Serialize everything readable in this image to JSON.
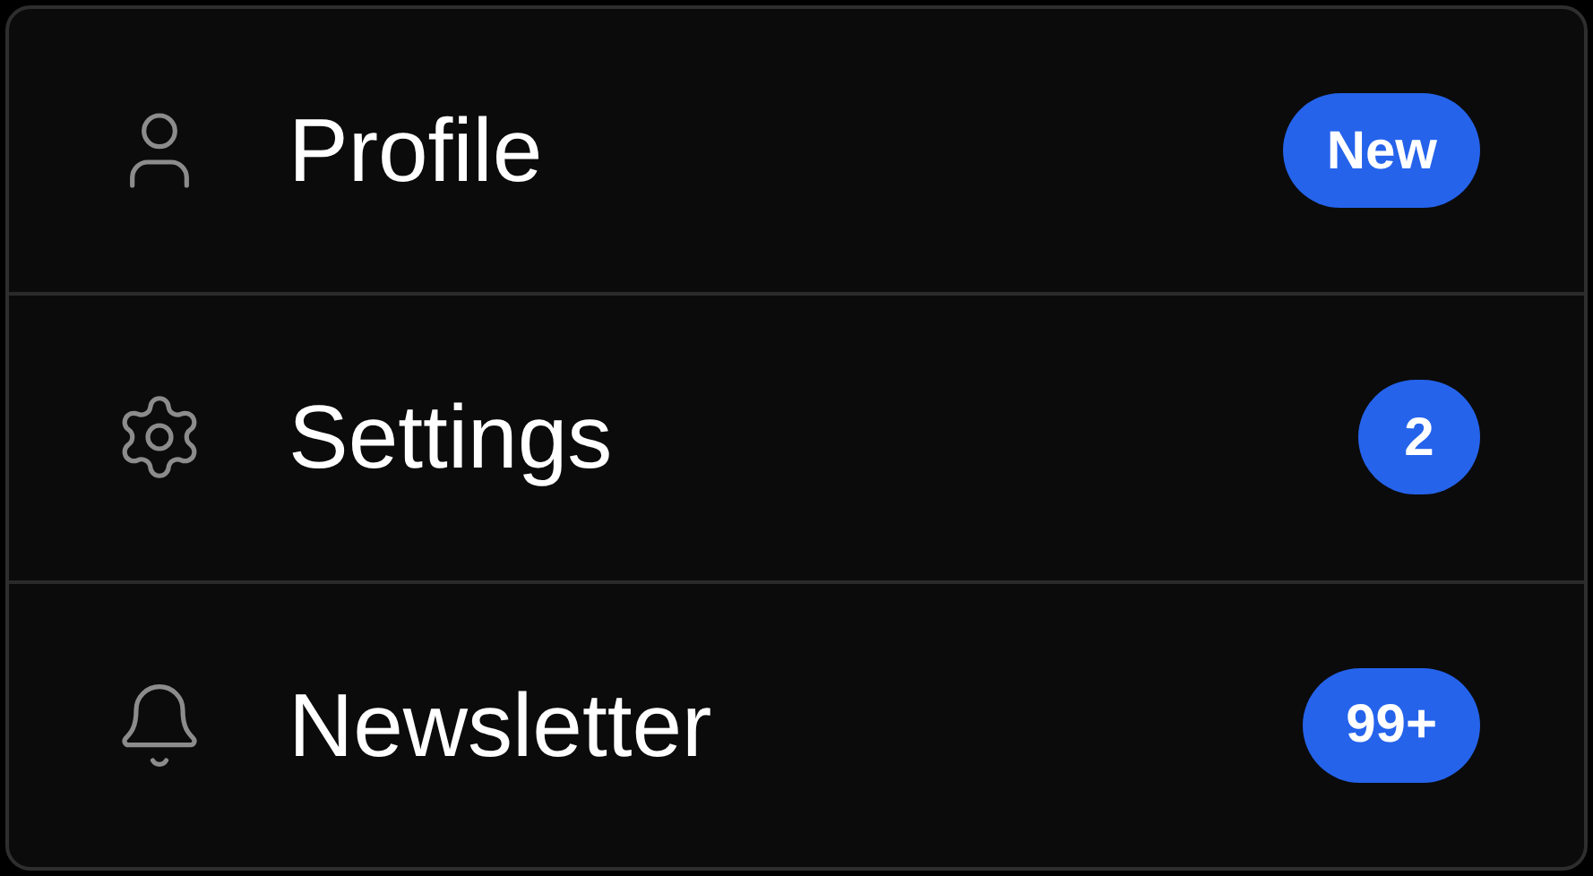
{
  "items": [
    {
      "kind": "user",
      "label": "Profile",
      "badge": "New"
    },
    {
      "kind": "gear",
      "label": "Settings",
      "badge": "2"
    },
    {
      "kind": "bell",
      "label": "Newsletter",
      "badge": "99+"
    }
  ]
}
